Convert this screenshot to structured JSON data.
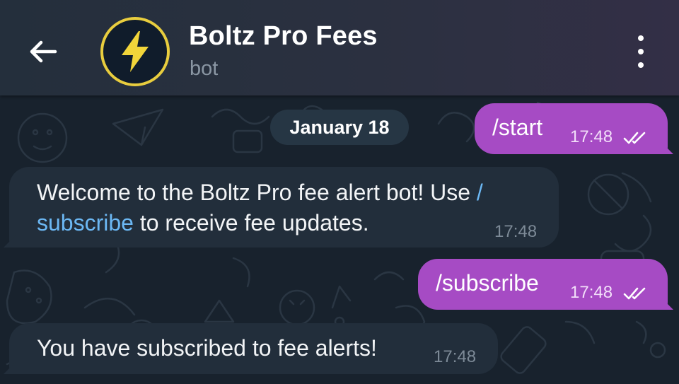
{
  "header": {
    "title": "Boltz Pro Fees",
    "subtitle": "bot",
    "back_icon": "arrow-left-icon",
    "avatar_icon": "lightning-bolt-icon",
    "menu_icon": "more-vertical-icon"
  },
  "date_separator": "January 18",
  "messages": [
    {
      "direction": "outgoing",
      "text": "/start",
      "time": "17:48",
      "status": "read"
    },
    {
      "direction": "incoming",
      "line1_pre": "Welcome to the Boltz Pro fee alert bot! Use ",
      "line1_link": "/",
      "line2_link": "subscribe",
      "line2_post": " to receive fee updates.",
      "time": "17:48"
    },
    {
      "direction": "outgoing",
      "text": "/subscribe",
      "time": "17:48",
      "status": "read"
    },
    {
      "direction": "incoming",
      "text": "You have subscribed to fee alerts!",
      "time": "17:48"
    }
  ],
  "colors": {
    "outgoing_bubble": "#a64bc4",
    "incoming_bubble": "#222e3b",
    "link": "#6cb8f4",
    "avatar_ring": "#e8cd3e",
    "chat_background": "#18222d"
  }
}
